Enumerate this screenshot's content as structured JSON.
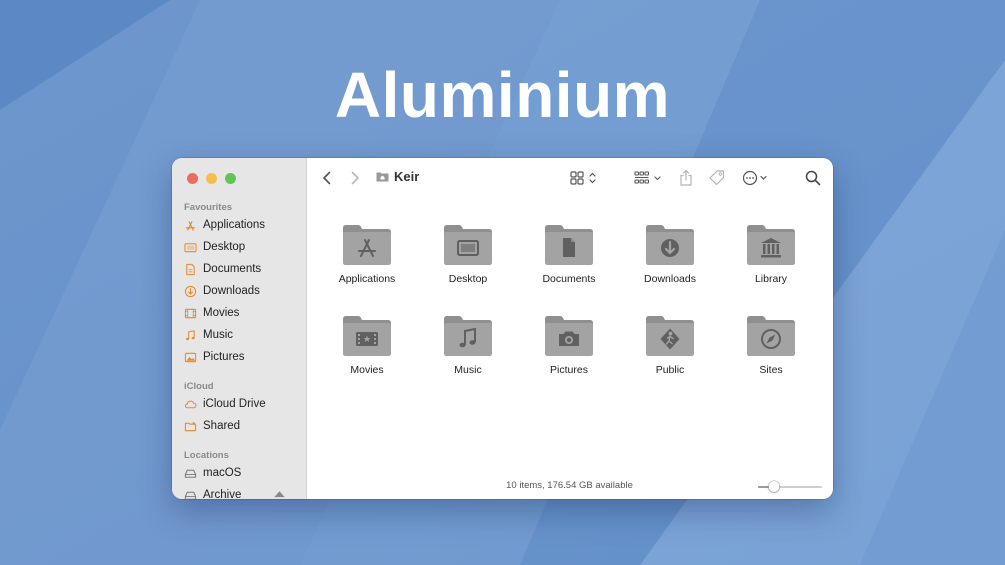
{
  "headline": "Aluminium",
  "colors": {
    "background": "#6a93cc",
    "sidebar_icon": "#e8872a",
    "folder_body": "#9b9b9b",
    "folder_glyph": "#5e5e5e"
  },
  "window": {
    "title": "Keir",
    "title_icon": "home-folder-icon",
    "status": "10 items, 176.54 GB available",
    "icon_size_fraction": 0.25
  },
  "toolbar": {
    "back_icon": "chevron-left-icon",
    "forward_icon": "chevron-right-icon",
    "view_icon": "icon-grid-icon",
    "group_icon": "group-by-icon",
    "share_icon": "share-icon",
    "tag_icon": "tag-icon",
    "more_icon": "ellipsis-circle-icon",
    "search_icon": "search-icon"
  },
  "sidebar": {
    "favourites_label": "Favourites",
    "icloud_label": "iCloud",
    "locations_label": "Locations",
    "favourites": [
      {
        "label": "Applications",
        "icon": "applications-icon"
      },
      {
        "label": "Desktop",
        "icon": "desktop-icon"
      },
      {
        "label": "Documents",
        "icon": "document-icon"
      },
      {
        "label": "Downloads",
        "icon": "download-icon"
      },
      {
        "label": "Movies",
        "icon": "film-icon"
      },
      {
        "label": "Music",
        "icon": "music-note-icon"
      },
      {
        "label": "Pictures",
        "icon": "picture-icon"
      }
    ],
    "icloud": [
      {
        "label": "iCloud Drive",
        "icon": "cloud-icon"
      },
      {
        "label": "Shared",
        "icon": "shared-folder-icon"
      }
    ],
    "locations": [
      {
        "label": "macOS",
        "icon": "disk-icon"
      },
      {
        "label": "Archive",
        "icon": "disk-icon",
        "eject_icon": "eject-icon"
      }
    ]
  },
  "files": [
    {
      "label": "Applications",
      "icon": "applications-folder-icon"
    },
    {
      "label": "Desktop",
      "icon": "desktop-folder-icon"
    },
    {
      "label": "Documents",
      "icon": "documents-folder-icon"
    },
    {
      "label": "Downloads",
      "icon": "downloads-folder-icon"
    },
    {
      "label": "Library",
      "icon": "library-folder-icon"
    },
    {
      "label": "Movies",
      "icon": "movies-folder-icon"
    },
    {
      "label": "Music",
      "icon": "music-folder-icon"
    },
    {
      "label": "Pictures",
      "icon": "pictures-folder-icon"
    },
    {
      "label": "Public",
      "icon": "public-folder-icon"
    },
    {
      "label": "Sites",
      "icon": "sites-folder-icon"
    }
  ]
}
